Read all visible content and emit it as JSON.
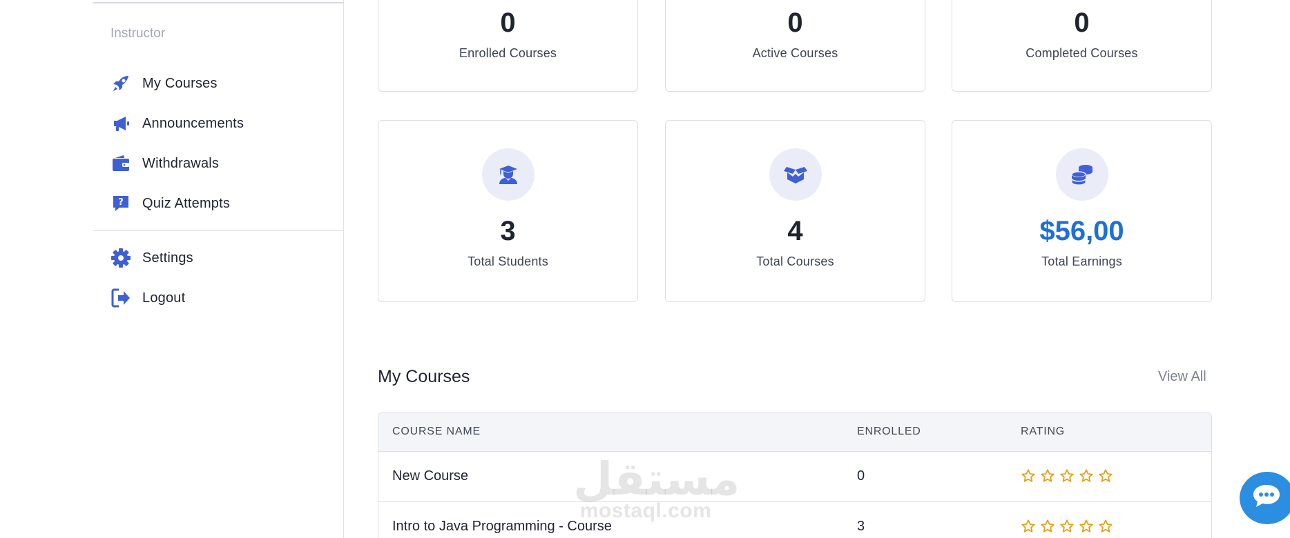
{
  "sidebar": {
    "section_title": "Instructor",
    "items": [
      {
        "label": "My Courses",
        "icon": "rocket-icon"
      },
      {
        "label": "Announcements",
        "icon": "megaphone-icon"
      },
      {
        "label": "Withdrawals",
        "icon": "wallet-icon"
      },
      {
        "label": "Quiz Attempts",
        "icon": "question-icon"
      },
      {
        "label": "Settings",
        "icon": "gear-icon"
      },
      {
        "label": "Logout",
        "icon": "logout-icon"
      }
    ]
  },
  "stats_top": [
    {
      "value": "0",
      "label": "Enrolled Courses"
    },
    {
      "value": "0",
      "label": "Active Courses"
    },
    {
      "value": "0",
      "label": "Completed Courses"
    }
  ],
  "stats_bottom": [
    {
      "value": "3",
      "label": "Total Students",
      "icon": "graduate-icon"
    },
    {
      "value": "4",
      "label": "Total Courses",
      "icon": "box-icon"
    },
    {
      "value": "$56,00",
      "label": "Total Earnings",
      "icon": "coins-icon"
    }
  ],
  "courses": {
    "title": "My Courses",
    "view_all": "View All",
    "columns": [
      "COURSE NAME",
      "ENROLLED",
      "RATING"
    ],
    "rows": [
      {
        "name": "New Course",
        "enrolled": "0",
        "rating": 0
      },
      {
        "name": "Intro to Java Programming - Course",
        "enrolled": "3",
        "rating": 0
      }
    ]
  },
  "watermark": {
    "arabic": "مستقل",
    "latin": "mostaql.com"
  },
  "colors": {
    "accent": "#3e5fd6",
    "earnings": "#1f6fd8",
    "star": "#e3a21a",
    "chat": "#2c8ee0"
  }
}
